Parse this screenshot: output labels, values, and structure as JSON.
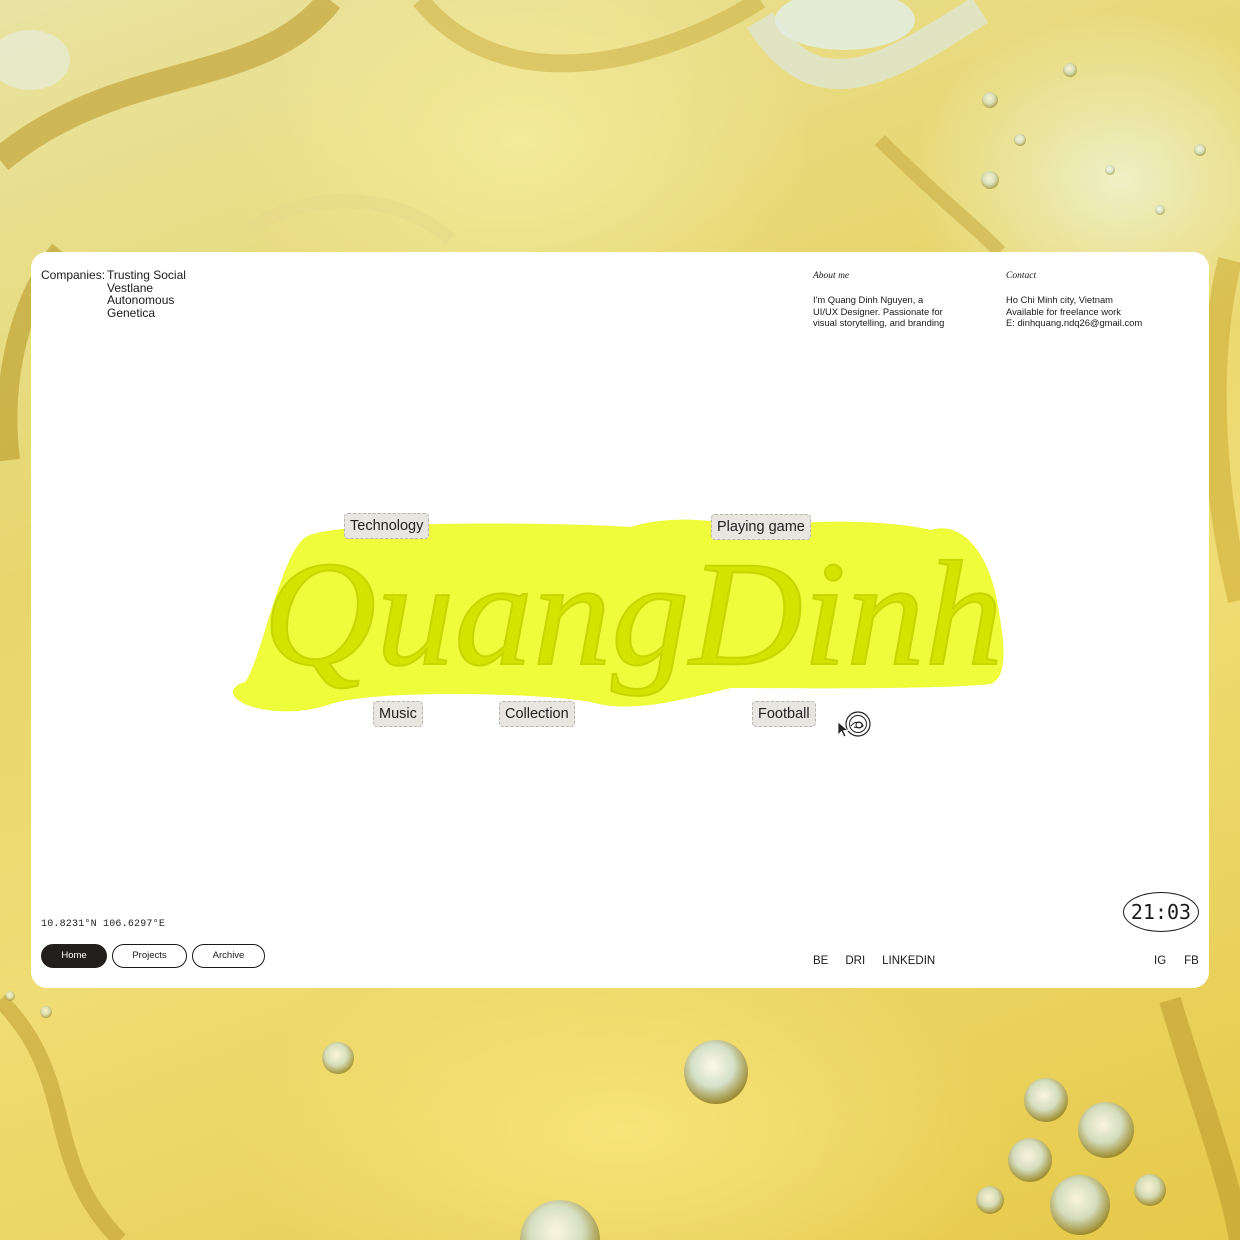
{
  "companies": {
    "label": "Companies:",
    "items": [
      "Trusting Social",
      "Vestlane",
      "Autonomous",
      "Genetica"
    ]
  },
  "about": {
    "heading": "About me",
    "lines": [
      "I'm Quang Dinh Nguyen, a",
      "UI/UX Designer. Passionate for",
      "visual storytelling, and branding"
    ]
  },
  "contact": {
    "heading": "Contact",
    "lines": [
      "Ho Chi Minh city, Vietnam",
      "Available for freelance work",
      "E: dinhquang.ndq26@gmail.com"
    ]
  },
  "hero": {
    "name": "QuangDinh",
    "highlight_color": "#eefc3c",
    "text_color": "#d3e400",
    "tags": [
      "Technology",
      "Playing game",
      "Music",
      "Collection",
      "Football"
    ]
  },
  "footer": {
    "coordinates": "10.8231°N 106.6297°E",
    "nav": [
      "Home",
      "Projects",
      "Archive"
    ],
    "active_nav": "Home",
    "clock": "21:03",
    "links_mid": [
      "BE",
      "DRI",
      "LINKEDIN"
    ],
    "links_right": [
      "IG",
      "FB"
    ]
  },
  "icons": {
    "cursor": "pointer-cursor-icon"
  }
}
